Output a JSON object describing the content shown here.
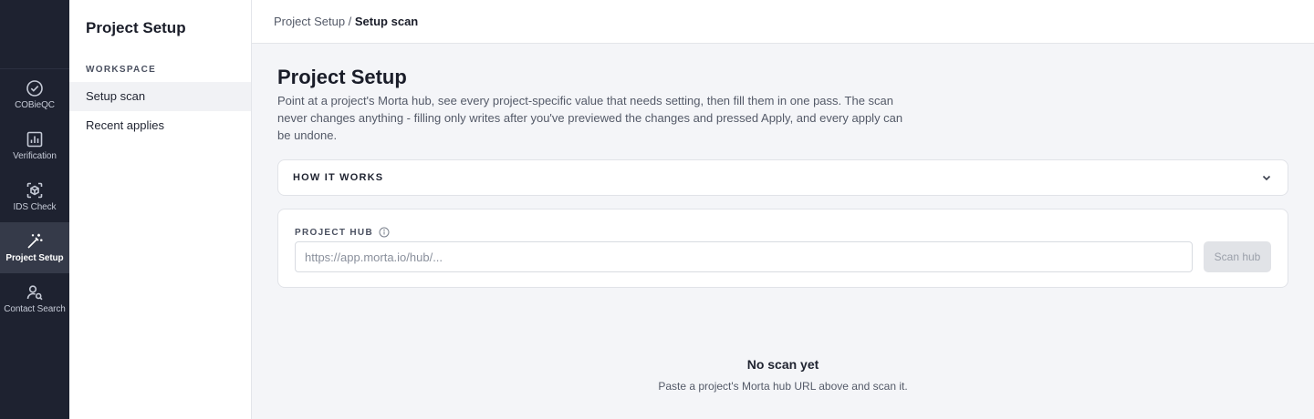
{
  "rail": {
    "items": [
      {
        "label": "COBieQC",
        "icon": "check-circle-icon",
        "active": false
      },
      {
        "label": "Verification",
        "icon": "bar-chart-icon",
        "active": false
      },
      {
        "label": "IDS Check",
        "icon": "scan-cube-icon",
        "active": false
      },
      {
        "label": "Project Setup",
        "icon": "magic-wand-icon",
        "active": true
      },
      {
        "label": "Contact Search",
        "icon": "user-search-icon",
        "active": false
      }
    ]
  },
  "sidebar": {
    "title": "Project Setup",
    "section": "WORKSPACE",
    "items": [
      {
        "label": "Setup scan",
        "active": true
      },
      {
        "label": "Recent applies",
        "active": false
      }
    ]
  },
  "breadcrumb": {
    "parent": "Project Setup",
    "separator": " / ",
    "current": "Setup scan"
  },
  "main": {
    "title": "Project Setup",
    "description": "Point at a project's Morta hub, see every project-specific value that needs setting, then fill them in one pass. The scan never changes anything - filling only writes after you've previewed the changes and pressed Apply, and every apply can be undone.",
    "how_it_works": "HOW IT WORKS",
    "hub": {
      "label": "PROJECT HUB",
      "value": "",
      "placeholder": "https://app.morta.io/hub/...",
      "button": "Scan hub"
    },
    "empty": {
      "title": "No scan yet",
      "subtitle": "Paste a project's Morta hub URL above and scan it."
    }
  },
  "colors": {
    "rail_bg": "#1e2230",
    "rail_active": "#353a49",
    "page_bg": "#f4f5f8",
    "button_disabled": "#e1e3e7"
  }
}
